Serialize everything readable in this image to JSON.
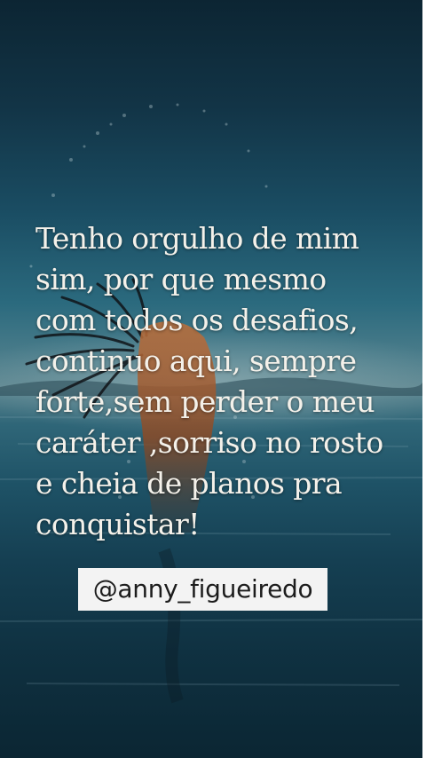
{
  "quote": {
    "lines": [
      "Tenho orgulho de mim",
      "sim, por que mesmo",
      "com todos os desafios,",
      "continuo aqui, sempre",
      "forte,sem perder o meu",
      "caráter ,sorriso no rosto",
      "e cheia de planos pra",
      "conquistar!"
    ]
  },
  "handle": "@anny_figueiredo",
  "colors": {
    "sky_top": "#0c2533",
    "horizon": "#5e8791",
    "sea_bottom": "#0b2633",
    "text": "#f4f1ea",
    "handle_bg": "#f3f3f3"
  }
}
